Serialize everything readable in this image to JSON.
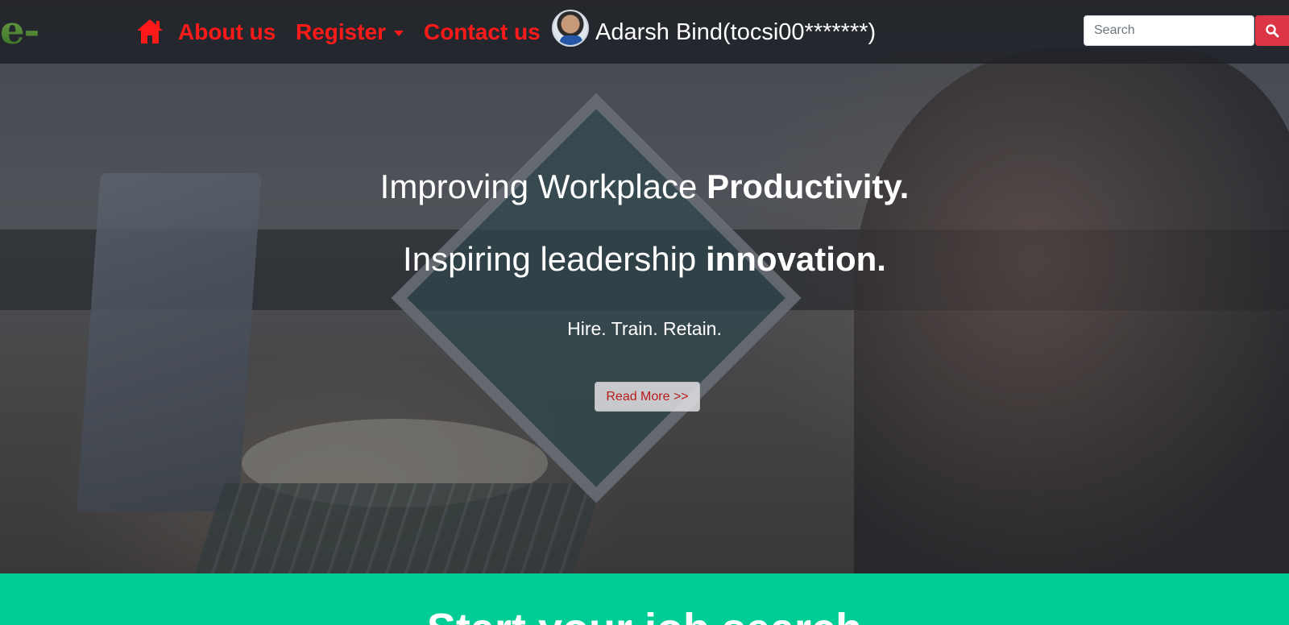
{
  "navbar": {
    "brand": "e-Jobs",
    "links": {
      "home_icon": "home-icon",
      "about": "About us",
      "register": "Register",
      "contact": "Contact us"
    },
    "user": {
      "name": "Adarsh Bind(tocsi00*******)"
    },
    "search": {
      "placeholder": "Search",
      "button_icon": "search-icon"
    }
  },
  "hero": {
    "line1_regular": "Improving Workplace ",
    "line1_bold": "Productivity.",
    "line2_regular": "Inspiring leadership ",
    "line2_bold": "innovation.",
    "tagline": "Hire. Train. Retain.",
    "cta": "Read More >>"
  },
  "section": {
    "title": "Start your job search"
  },
  "colors": {
    "nav_link": "#ff1a1a",
    "search_button": "#dc3545",
    "section_bg": "#00cc96"
  }
}
